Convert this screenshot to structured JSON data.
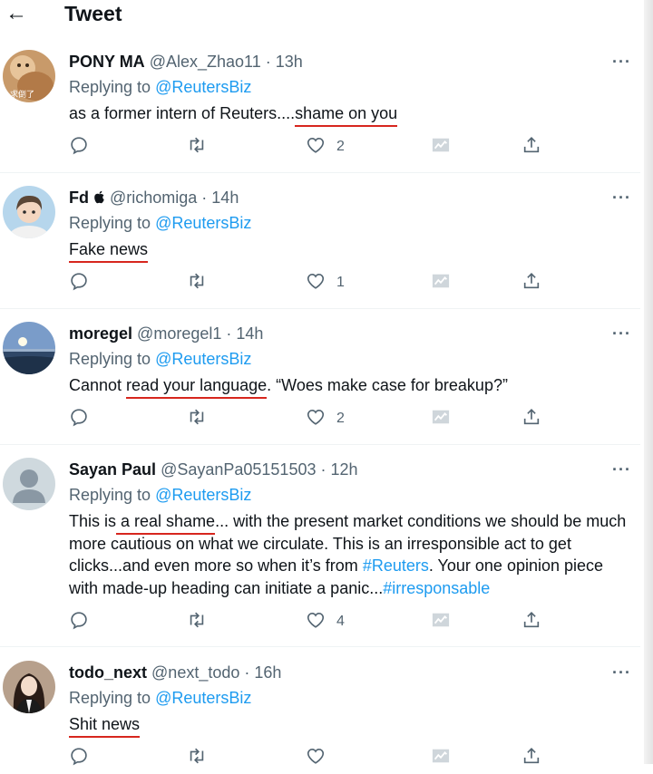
{
  "header": {
    "title": "Tweet",
    "back_icon": "arrow-left-icon"
  },
  "colors": {
    "link": "#1d9bf0",
    "secondary": "#536471",
    "underline_mark": "#d7261e"
  },
  "replying_prefix": "Replying to ",
  "tweets": [
    {
      "name": "PONY MA",
      "handle": "@Alex_Zhao11 · 13h",
      "replying_to": "@ReutersBiz",
      "segments": [
        {
          "t": "as a former intern of Reuters...."
        },
        {
          "t": "shame on you",
          "u": true
        }
      ],
      "likes": "2",
      "avatar_caption": "求倒了"
    },
    {
      "name": "Fd ",
      "handle": "@richomiga · 14h",
      "replying_to": "@ReutersBiz",
      "segments": [
        {
          "t": "Fake news",
          "u": true
        }
      ],
      "likes": "1"
    },
    {
      "name": "moregel",
      "handle": "@moregel1 · 14h",
      "replying_to": "@ReutersBiz",
      "segments": [
        {
          "t": "Cannot "
        },
        {
          "t": "read your language",
          "u": true
        },
        {
          "t": ". “Woes make case for breakup?”"
        }
      ],
      "likes": "2"
    },
    {
      "name": "Sayan Paul",
      "handle": "@SayanPa05151503 · 12h",
      "replying_to": "@ReutersBiz",
      "segments": [
        {
          "t": "This is"
        },
        {
          "t": " a real shame",
          "u": true
        },
        {
          "t": "... with the present market conditions we should be much more cautious on what we circulate. This is an irresponsible act to get clicks...and even more so when it’s from "
        },
        {
          "t": "#Reuters",
          "link": true
        },
        {
          "t": ". Your one opinion piece with made-up heading can initiate a panic..."
        },
        {
          "t": "#irresponsable",
          "link": true
        }
      ],
      "likes": "4"
    },
    {
      "name": "todo_next",
      "handle": "@next_todo · 16h",
      "replying_to": "@ReutersBiz",
      "segments": [
        {
          "t": "Shit news",
          "u": true
        }
      ],
      "likes": ""
    }
  ],
  "action_icons": [
    "reply-icon",
    "retweet-icon",
    "like-icon",
    "analytics-icon",
    "share-icon"
  ]
}
